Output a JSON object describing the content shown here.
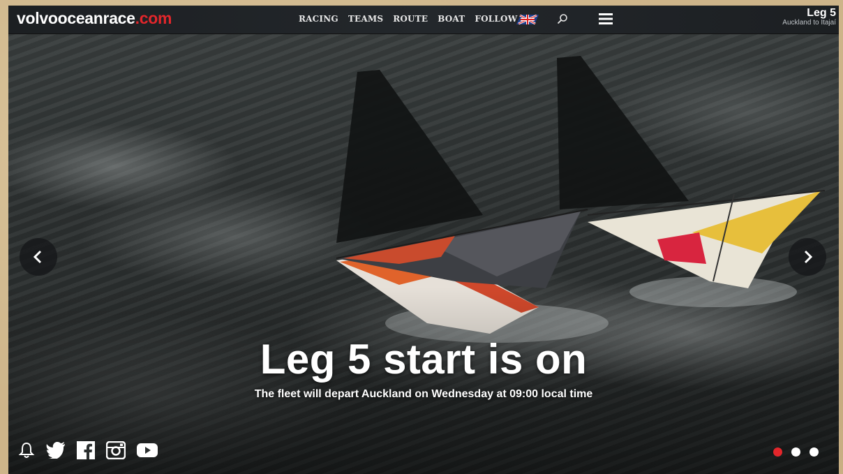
{
  "brand": {
    "name": "volvooceanrace",
    "tld": ".com"
  },
  "nav": {
    "items": [
      "RACING",
      "TEAMS",
      "ROUTE",
      "BOAT",
      "FOLLOW"
    ]
  },
  "icons": {
    "flag": "uk-flag-icon",
    "search": "search-icon",
    "menu": "hamburger-menu-icon"
  },
  "leg": {
    "title": "Leg 5",
    "subtitle": "Auckland to Itajaí"
  },
  "hero": {
    "headline": "Leg 5 start is on",
    "subtitle": "The fleet will depart Auckland on Wednesday at 09:00 local time"
  },
  "carousel": {
    "active_slide": 1,
    "slide_count": 3
  },
  "social": [
    "bell-icon",
    "twitter-icon",
    "facebook-icon",
    "instagram-icon",
    "youtube-icon"
  ],
  "colors": {
    "accent": "#e3262b",
    "nav_bg": "#1f2327",
    "text": "#ffffff"
  }
}
